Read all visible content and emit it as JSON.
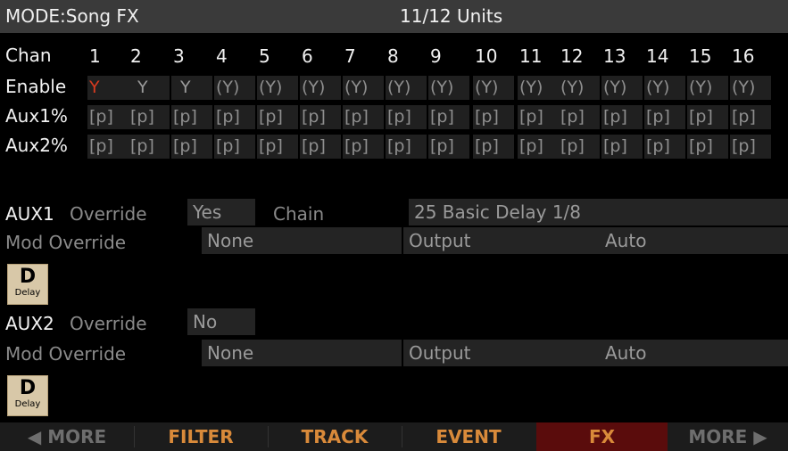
{
  "header": {
    "mode": "MODE:Song FX",
    "units": "11/12 Units"
  },
  "grid": {
    "chan_label": "Chan",
    "enable_label": "Enable",
    "aux1_label": "Aux1%",
    "aux2_label": "Aux2%",
    "channels": [
      "1",
      "2",
      "3",
      "4",
      "5",
      "6",
      "7",
      "8",
      "9",
      "10",
      "11",
      "12",
      "13",
      "14",
      "15",
      "16"
    ],
    "enable": [
      "Y",
      "Y",
      "Y",
      "(Y)",
      "(Y)",
      "(Y)",
      "(Y)",
      "(Y)",
      "(Y)",
      "(Y)",
      "(Y)",
      "(Y)",
      "(Y)",
      "(Y)",
      "(Y)",
      "(Y)"
    ],
    "aux1": [
      "[p]",
      "[p]",
      "[p]",
      "[p]",
      "[p]",
      "[p]",
      "[p]",
      "[p]",
      "[p]",
      "[p]",
      "[p]",
      "[p]",
      "[p]",
      "[p]",
      "[p]",
      "[p]"
    ],
    "aux2": [
      "[p]",
      "[p]",
      "[p]",
      "[p]",
      "[p]",
      "[p]",
      "[p]",
      "[p]",
      "[p]",
      "[p]",
      "[p]",
      "[p]",
      "[p]",
      "[p]",
      "[p]",
      "[p]"
    ]
  },
  "aux1": {
    "label": "AUX1",
    "override_label": "Override",
    "override_value": "Yes",
    "chain_label": "Chain",
    "chain_value": "25 Basic Delay 1/8",
    "mod_override_label": "Mod Override",
    "mod_override_value": "None",
    "output_label": "Output",
    "output_value": "Auto",
    "icon_letter": "D",
    "icon_caption": "Delay"
  },
  "aux2": {
    "label": "AUX2",
    "override_label": "Override",
    "override_value": "No",
    "mod_override_label": "Mod Override",
    "mod_override_value": "None",
    "output_label": "Output",
    "output_value": "Auto",
    "icon_letter": "D",
    "icon_caption": "Delay"
  },
  "softkeys": {
    "more_left": "◀ MORE",
    "filter": "FILTER",
    "track": "TRACK",
    "event": "EVENT",
    "fx": "FX",
    "more_right": "MORE ▶"
  },
  "colors": {
    "accent": "#d98a3a",
    "active_tab": "#5a0c0c",
    "enable_first": "#d63a1f"
  }
}
